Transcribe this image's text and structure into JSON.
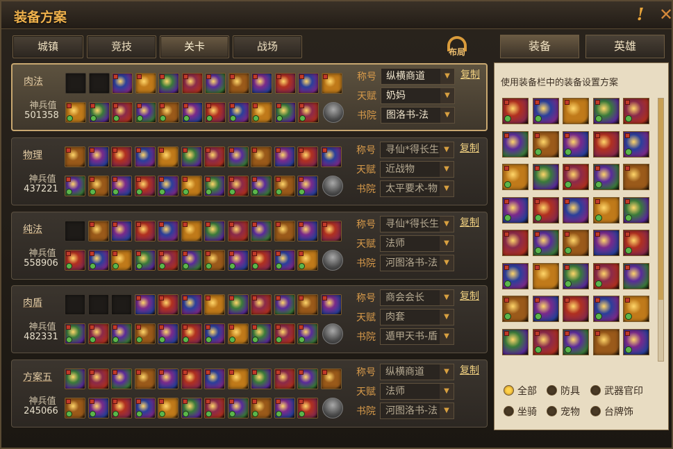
{
  "window": {
    "title": "装备方案"
  },
  "tabs": [
    {
      "label": "城镇",
      "active": false
    },
    {
      "label": "竞技",
      "active": false
    },
    {
      "label": "关卡",
      "active": true
    },
    {
      "label": "战场",
      "active": false
    }
  ],
  "layout_button": {
    "label": "布局"
  },
  "right_tabs": [
    {
      "label": "装备",
      "active": true
    },
    {
      "label": "英雄",
      "active": false
    }
  ],
  "field_labels": {
    "title": "称号",
    "talent": "天赋",
    "academy": "书院"
  },
  "copy_label": "复制",
  "power_label": "神兵值",
  "plans": [
    {
      "name": "肉法",
      "power": "501358",
      "title": "纵横商道",
      "talent": "奶妈",
      "academy": "图洛书-法",
      "selected": true,
      "top_empty": 2
    },
    {
      "name": "物理",
      "power": "437221",
      "title": "寻仙*得长生",
      "talent": "近战物",
      "academy": "太平要术-物",
      "selected": false,
      "top_empty": 0
    },
    {
      "name": "纯法",
      "power": "558906",
      "title": "寻仙*得长生",
      "talent": "法师",
      "academy": "河图洛书-法",
      "selected": false,
      "top_empty": 1
    },
    {
      "name": "肉盾",
      "power": "482331",
      "title": "商会会长",
      "talent": "肉套",
      "academy": "遁甲天书-盾",
      "selected": false,
      "top_empty": 3
    },
    {
      "name": "方案五",
      "power": "245066",
      "title": "纵横商道",
      "talent": "法师",
      "academy": "河图洛书-法",
      "selected": false,
      "top_empty": 0
    }
  ],
  "panel": {
    "hint": "使用装备栏中的装备设置方案"
  },
  "filters": [
    {
      "label": "全部",
      "on": true
    },
    {
      "label": "防具",
      "on": false
    },
    {
      "label": "武器官印",
      "on": false
    },
    {
      "label": "坐骑",
      "on": false
    },
    {
      "label": "宠物",
      "on": false
    },
    {
      "label": "台牌饰",
      "on": false
    }
  ],
  "colors": {
    "accent": "#f0b24c",
    "selected_border": "#c9a870",
    "item_palette": [
      "#7a2a8a",
      "#b03020",
      "#2a3f9a",
      "#c07a1a",
      "#3a7a3a",
      "#8a2a4a",
      "#5a2a9a",
      "#9a5a1a"
    ]
  }
}
